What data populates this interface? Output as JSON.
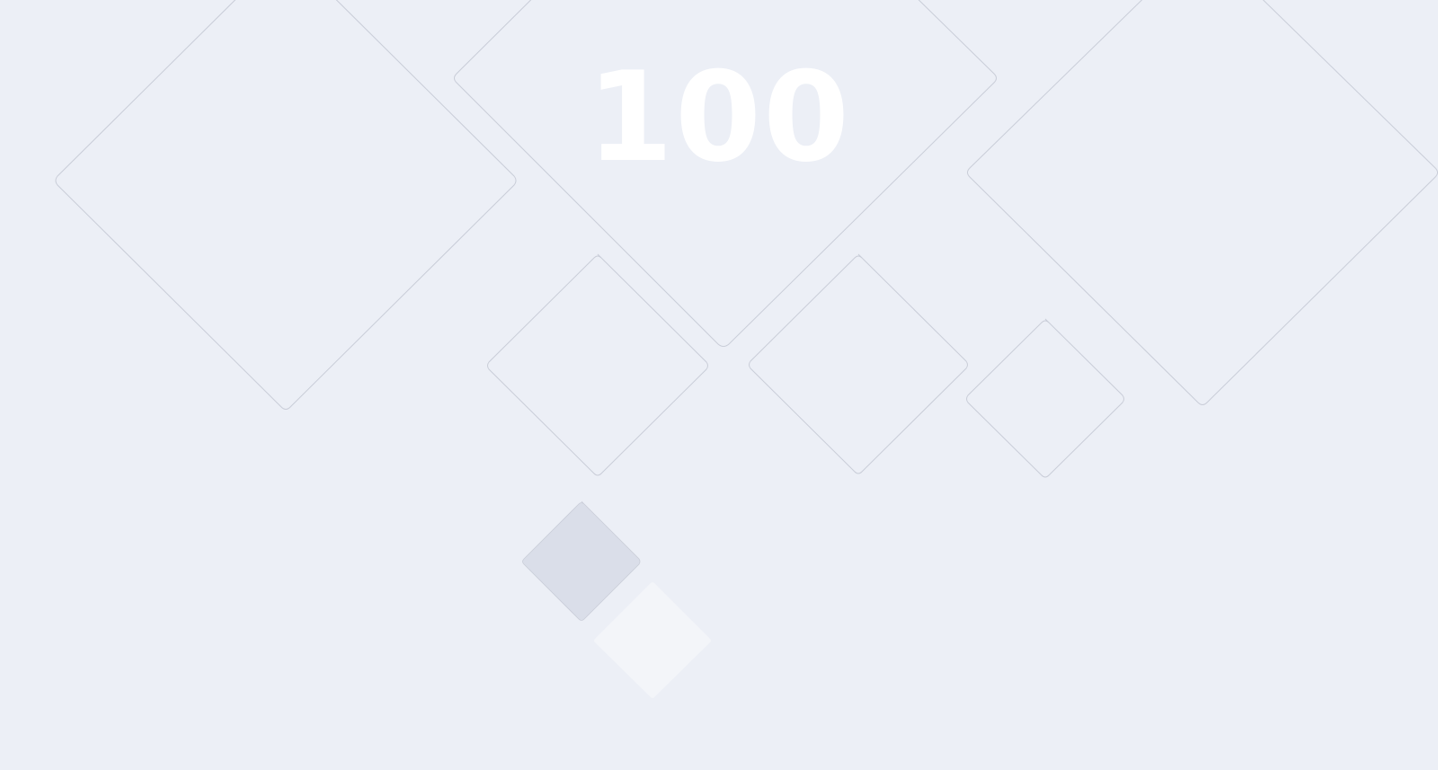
{
  "game": {
    "score": "100"
  },
  "colors": {
    "background": "#ECEFF6",
    "outline": "#C9CDD8",
    "piece_active": "#DADEE9",
    "piece_ghost": "#F3F5F9",
    "score_text": "#FFFFFF"
  }
}
